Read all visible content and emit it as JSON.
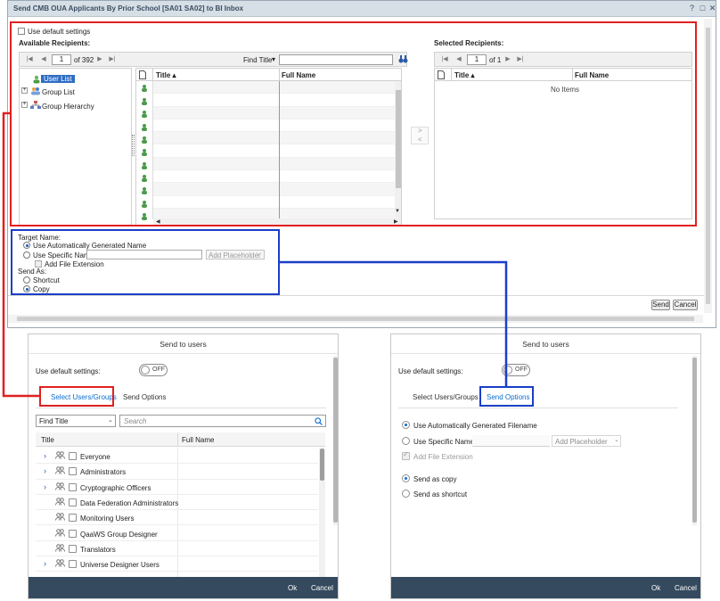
{
  "dialog": {
    "title": "Send CMB OUA Applicants By Prior School [SA01 SA02] to BI Inbox",
    "win_buttons": [
      "?",
      "□",
      "✕"
    ],
    "use_default_label": "Use default settings",
    "available_label": "Available Recipients:",
    "selected_label": "Selected Recipients:",
    "page_value": "1",
    "page_of": "of 392",
    "find_label": "Find Title",
    "find_arrow": "▾",
    "tree": [
      "User List",
      "Group List",
      "Group Hierarchy"
    ],
    "col_title": "Title ▴",
    "col_fullname": "Full Name",
    "sel_page_value": "1",
    "sel_page_of": "of 1",
    "sel_col_title": "Title ▴",
    "sel_col_fullname": "Full Name",
    "no_items": "No Items",
    "move_right": ">",
    "move_left": "<",
    "target_name_label": "Target Name:",
    "opt_auto": "Use Automatically Generated Name",
    "opt_specific": "Use Specific Name",
    "add_placeholder": "Add Placeholder",
    "add_ext": "Add File Extension",
    "send_as_label": "Send As:",
    "opt_shortcut": "Shortcut",
    "opt_copy": "Copy",
    "send_btn": "Send",
    "cancel_btn": "Cancel"
  },
  "left_panel": {
    "title": "Send to users",
    "default_label": "Use default settings:",
    "toggle": "OFF",
    "tab_users": "Select Users/Groups",
    "tab_options": "Send Options",
    "find_select": "Find Title",
    "search_placeholder": "Search",
    "col_title": "Title",
    "col_fullname": "Full Name",
    "rows": [
      "Everyone",
      "Administrators",
      "Cryptographic Officers",
      "Data Federation Administrators",
      "Monitoring Users",
      "QaaWS Group Designer",
      "Translators",
      "Universe Designer Users"
    ],
    "ok": "Ok",
    "cancel": "Cancel"
  },
  "right_panel": {
    "title": "Send to users",
    "default_label": "Use default settings:",
    "toggle": "OFF",
    "tab_users": "Select Users/Groups",
    "tab_options": "Send Options",
    "opt_auto": "Use Automatically Generated Filename",
    "opt_specific": "Use Specific Name",
    "add_placeholder": "Add Placeholder",
    "add_ext": "Add File Extension",
    "opt_copy": "Send as copy",
    "opt_shortcut": "Send as shortcut",
    "ok": "Ok",
    "cancel": "Cancel"
  },
  "colors": {
    "red_callout": "#e02020",
    "blue_callout": "#1a3fc8",
    "sap_blue": "#0a6ed1",
    "footer": "#354a5f"
  }
}
